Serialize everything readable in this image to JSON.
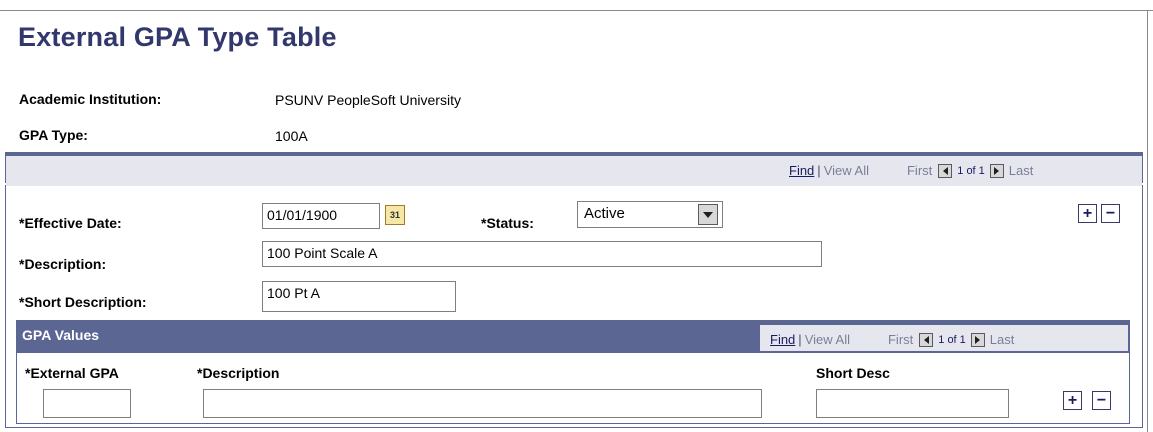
{
  "page": {
    "title": "External GPA Type Table"
  },
  "header_fields": {
    "institution_label": "Academic Institution:",
    "institution_value": "PSUNV PeopleSoft University",
    "gpa_type_label": "GPA Type:",
    "gpa_type_value": "100A"
  },
  "outer_nav": {
    "find": "Find",
    "view_all": "View All",
    "first": "First",
    "count": "1 of 1",
    "last": "Last"
  },
  "form": {
    "effective_date_label": "*Effective Date:",
    "effective_date_value": "01/01/1900",
    "calendar_icon_text": "31",
    "status_label": "*Status:",
    "status_value": "Active",
    "description_label": "*Description:",
    "description_value": "100 Point Scale A",
    "short_description_label": "*Short Description:",
    "short_description_value": "100 Pt A",
    "add_symbol": "+",
    "remove_symbol": "−"
  },
  "gpa_values": {
    "title": "GPA Values",
    "nav": {
      "find": "Find",
      "view_all": "View All",
      "first": "First",
      "count": "1 of 1",
      "last": "Last"
    },
    "columns": [
      "*External GPA",
      "*Description",
      "Short Desc"
    ],
    "row": {
      "external_gpa": "",
      "description": "",
      "short_desc": ""
    }
  },
  "colors": {
    "title": "#32386c",
    "header_bar": "#5b6693",
    "subheader": "#e6e7ee"
  },
  "icons": [
    "calendar-icon",
    "dropdown-arrow-icon",
    "first-arrow-icon",
    "last-arrow-icon",
    "add-row-icon",
    "delete-row-icon"
  ]
}
